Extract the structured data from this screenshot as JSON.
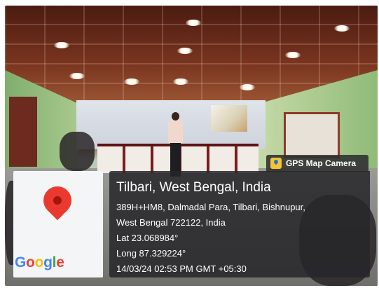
{
  "location": {
    "title": "Tilbari, West Bengal, India",
    "address_line1": "389H+HM8, Dalmadal Para, Tilbari, Bishnupur,",
    "address_line2": "West Bengal 722122, India",
    "lat": "Lat 23.068984°",
    "long": "Long 87.329224°",
    "datetime": "14/03/24 02:53 PM GMT +05:30"
  },
  "badge": {
    "label": "GPS Map Camera",
    "icon": "gps-map-camera-icon"
  },
  "map": {
    "brand": [
      "G",
      "o",
      "o",
      "g",
      "l",
      "e"
    ],
    "pin_icon": "location-pin-icon"
  },
  "colors": {
    "pin": "#ea3a2f",
    "card_bg": "#26262a",
    "badge_icon": "#f4c431"
  }
}
